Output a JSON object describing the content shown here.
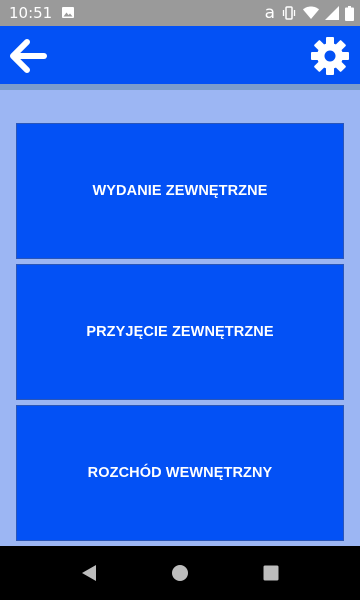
{
  "status_bar": {
    "time": "10:51",
    "icons": [
      "photo-icon",
      "amazon-a-icon",
      "vibrate-icon",
      "wifi-icon",
      "signal-icon",
      "battery-icon"
    ],
    "amazon_glyph": "a"
  },
  "header": {
    "back_icon": "arrow-left-icon",
    "settings_icon": "gear-icon"
  },
  "menu": {
    "items": [
      {
        "label": "WYDANIE ZEWNĘTRZNE"
      },
      {
        "label": "PRZYJĘCIE ZEWNĘTRZNE"
      },
      {
        "label": "ROZCHÓD WEWNĘTRZNY"
      }
    ]
  },
  "nav_bar": {
    "icons": [
      "nav-back-icon",
      "nav-home-icon",
      "nav-recents-icon"
    ]
  },
  "colors": {
    "primary": "#0351f5",
    "background": "#9cb6f3",
    "status_bar": "#9a9a9a",
    "nav_bar": "#000000",
    "text": "#ffffff"
  }
}
